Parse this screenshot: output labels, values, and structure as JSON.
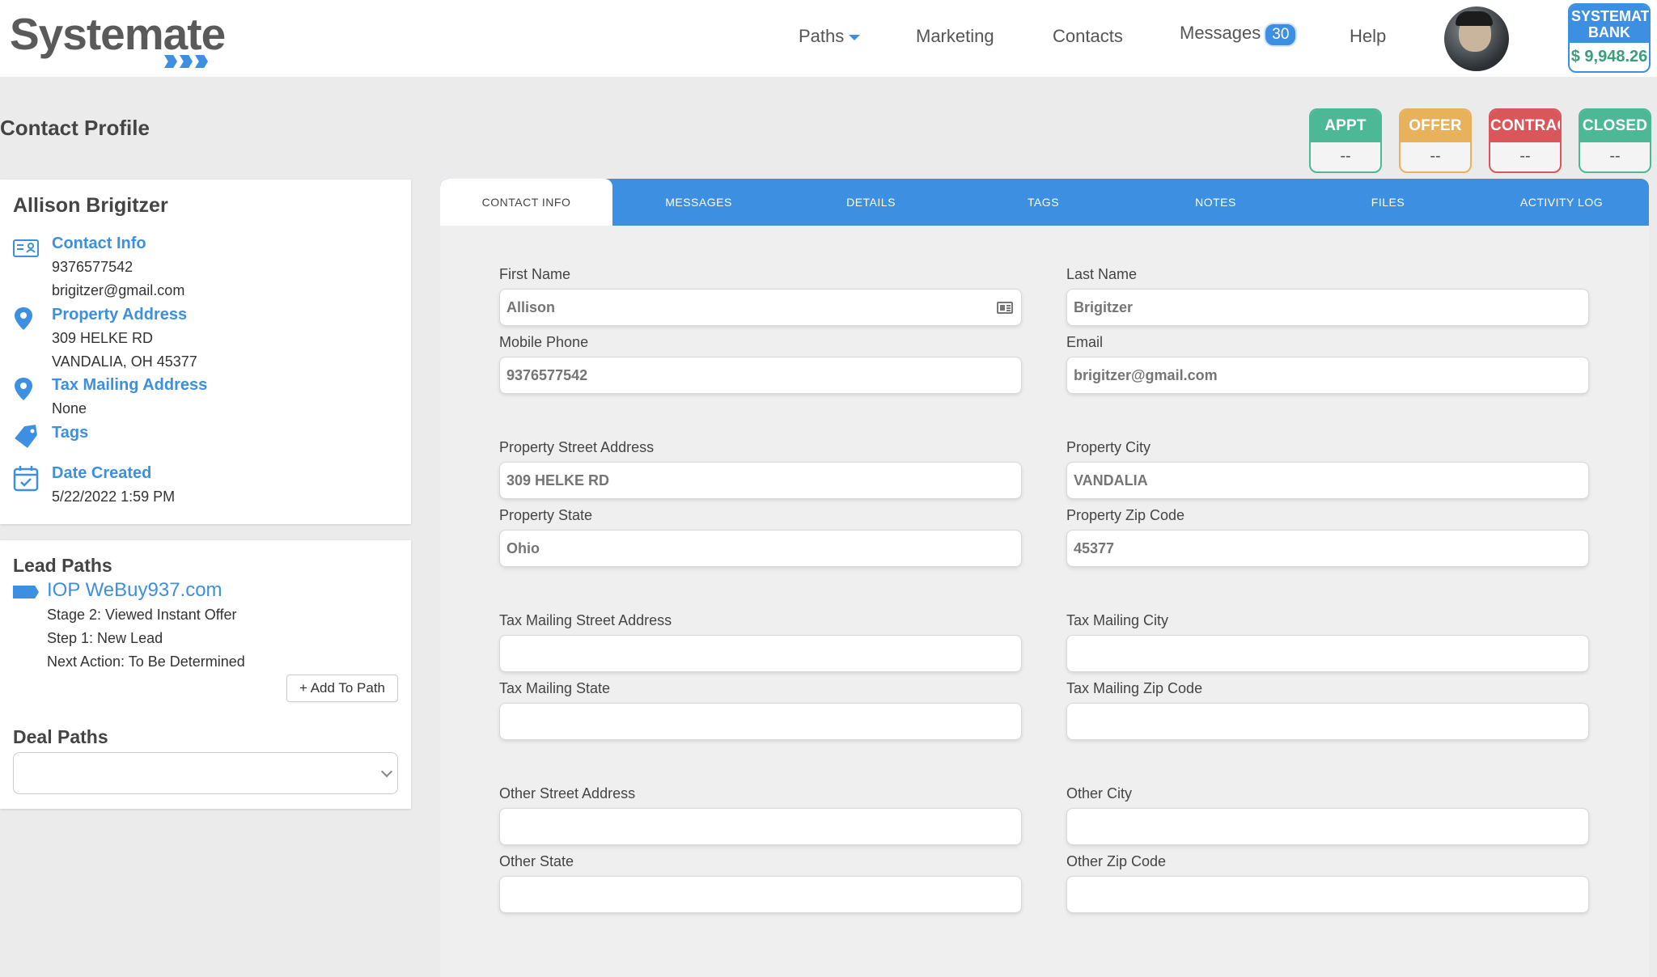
{
  "app": {
    "logo_text": "Systemate",
    "nav": {
      "paths": "Paths",
      "marketing": "Marketing",
      "contacts": "Contacts",
      "messages": "Messages",
      "messages_badge": "30",
      "help": "Help"
    },
    "bank": {
      "title_line1": "SYSTEMATE",
      "title_line2": "BANK",
      "amount": "$ 9,948.26"
    }
  },
  "page": {
    "title": "Contact Profile"
  },
  "status_cards": [
    {
      "label": "APPT",
      "value": "--",
      "color": "#4cb896"
    },
    {
      "label": "OFFER",
      "value": "--",
      "color": "#e8b25c"
    },
    {
      "label": "CONTRACT",
      "value": "--",
      "color": "#d9575a"
    },
    {
      "label": "CLOSED",
      "value": "--",
      "color": "#4cb896"
    }
  ],
  "contact": {
    "name": "Allison Brigitzer",
    "contact_info_label": "Contact Info",
    "phone": "9376577542",
    "email": "brigitzer@gmail.com",
    "property_address_label": "Property Address",
    "property_address_line1": "309 HELKE RD",
    "property_address_line2": "VANDALIA, OH 45377",
    "tax_mailing_label": "Tax Mailing Address",
    "tax_mailing_value": "None",
    "tags_label": "Tags",
    "date_created_label": "Date Created",
    "date_created_value": "5/22/2022 1:59 PM"
  },
  "lead_paths": {
    "title": "Lead Paths",
    "path_name": "IOP WeBuy937.com",
    "stage": "Stage 2: Viewed Instant Offer",
    "step": "Step 1: New Lead",
    "next_action": "Next Action: To Be Determined",
    "add_button": "+ Add To Path"
  },
  "deal_paths": {
    "title": "Deal Paths",
    "selected": ""
  },
  "tabs": [
    "CONTACT INFO",
    "MESSAGES",
    "DETAILS",
    "TAGS",
    "NOTES",
    "FILES",
    "ACTIVITY LOG"
  ],
  "form": {
    "first_name": {
      "label": "First Name",
      "placeholder": "Allison"
    },
    "last_name": {
      "label": "Last Name",
      "placeholder": "Brigitzer"
    },
    "mobile_phone": {
      "label": "Mobile Phone",
      "placeholder": "9376577542"
    },
    "email": {
      "label": "Email",
      "placeholder": "brigitzer@gmail.com"
    },
    "property_street": {
      "label": "Property Street Address",
      "placeholder": "309 HELKE RD"
    },
    "property_city": {
      "label": "Property City",
      "placeholder": "VANDALIA"
    },
    "property_state": {
      "label": "Property State",
      "placeholder": "Ohio"
    },
    "property_zip": {
      "label": "Property Zip Code",
      "placeholder": "45377"
    },
    "tax_street": {
      "label": "Tax Mailing Street Address",
      "placeholder": ""
    },
    "tax_city": {
      "label": "Tax Mailing City",
      "placeholder": ""
    },
    "tax_state": {
      "label": "Tax Mailing State",
      "placeholder": ""
    },
    "tax_zip": {
      "label": "Tax Mailing Zip Code",
      "placeholder": ""
    },
    "other_street": {
      "label": "Other Street Address",
      "placeholder": ""
    },
    "other_city": {
      "label": "Other City",
      "placeholder": ""
    },
    "other_state": {
      "label": "Other State",
      "placeholder": ""
    },
    "other_zip": {
      "label": "Other Zip Code",
      "placeholder": ""
    }
  },
  "colors": {
    "accent": "#3d8fe2",
    "page_bg": "#ebebeb"
  }
}
